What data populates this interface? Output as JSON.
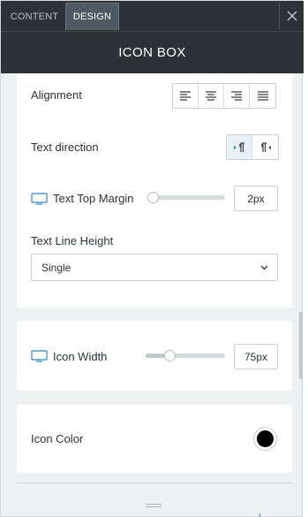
{
  "tabs": {
    "content_label": "CONTENT",
    "design_label": "DESIGN"
  },
  "header": {
    "title": "ICON BOX"
  },
  "text_settings": {
    "alignment": {
      "label": "Alignment",
      "options": [
        "left",
        "center",
        "right",
        "justify"
      ]
    },
    "text_direction": {
      "label": "Text direction",
      "options": [
        "ltr",
        "rtl"
      ],
      "selected": "ltr"
    },
    "text_top_margin": {
      "label": "Text Top Margin",
      "icon": "desktop-icon",
      "value": "2px",
      "slider_fraction": 0.02
    },
    "text_line_height": {
      "label": "Text Line Height",
      "value": "Single"
    }
  },
  "icon_settings": {
    "icon_width": {
      "label": "Icon Width",
      "icon": "desktop-icon",
      "value": "75px",
      "slider_fraction": 0.3
    }
  },
  "color_settings": {
    "icon_color": {
      "label": "Icon Color",
      "color": "#000000"
    }
  },
  "colors": {
    "header_bg": "#2e3238",
    "active_tab_bg": "#4d5a64",
    "panel_bg": "#eef0f1",
    "accent_blue": "#2e86c1"
  }
}
